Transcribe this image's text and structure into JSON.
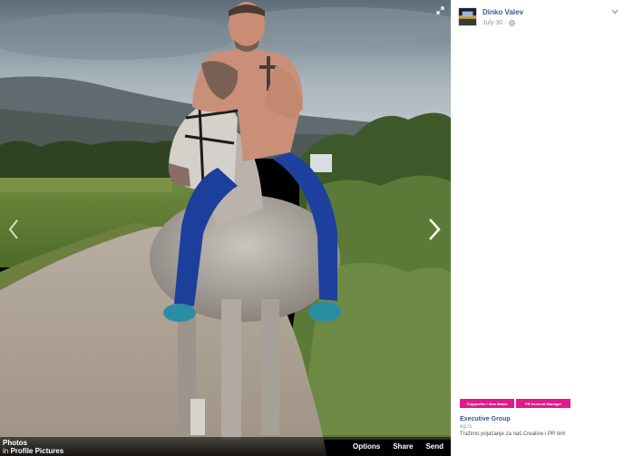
{
  "theater": {
    "album": {
      "title": "Photos",
      "in_word": "in",
      "link": "Profile Pictures"
    },
    "actions": [
      "Options",
      "Share",
      "Send"
    ],
    "icons": {
      "prev": "chevron-left-icon",
      "next": "chevron-right-icon",
      "expand": "expand-icon"
    }
  },
  "post": {
    "author": "Dinko Valev",
    "date": "July 30",
    "separator": "·",
    "privacy_icon": "globe-icon"
  },
  "sidebar_ad": {
    "images": [
      "Copywriter / Idea Maker",
      "PR Account Manager"
    ],
    "title": "Executive Group",
    "url": "eg.rs",
    "description": "Tražimo pojačanje za naš Creative i PR tim!",
    "accent_color": "#e0198c"
  },
  "colors": {
    "link": "#365899",
    "meta": "#90949c"
  }
}
